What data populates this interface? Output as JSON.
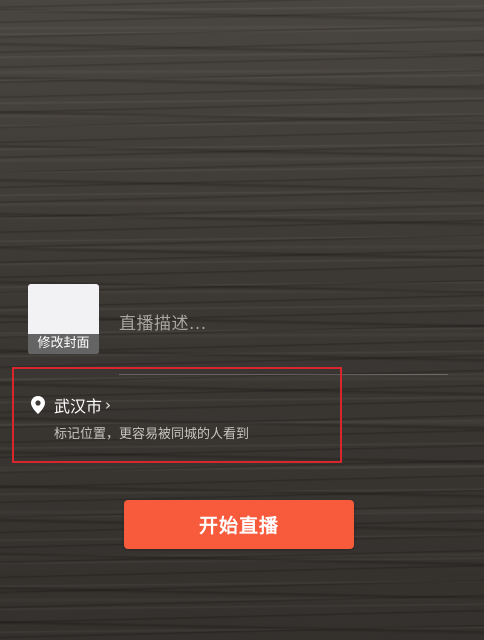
{
  "cover": {
    "label": "修改封面"
  },
  "description": {
    "placeholder": "直播描述..."
  },
  "location": {
    "icon": "location-pin-icon",
    "city": "武汉市",
    "chevron": "›",
    "hint": "标记位置，更容易被同城的人看到"
  },
  "actions": {
    "start_label": "开始直播",
    "start_color": "#f85a3c"
  },
  "annotation": {
    "highlight_color": "#d9262c"
  }
}
